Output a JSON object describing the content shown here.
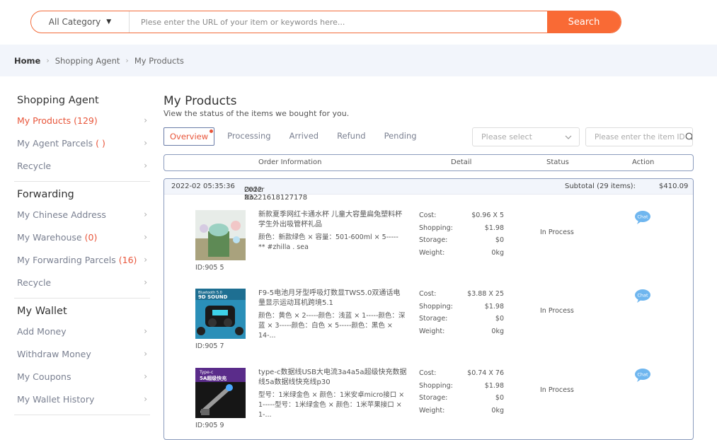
{
  "search": {
    "category_label": "All Category",
    "placeholder": "Plese enter the URL of your item or keywords here...",
    "button_label": "Search"
  },
  "breadcrumb": {
    "home": "Home",
    "level1": "Shopping Agent",
    "level2": "My Products"
  },
  "sidebar": {
    "sections": [
      {
        "title": "Shopping Agent",
        "items": [
          {
            "label": "My Products",
            "count": "(129)",
            "active": true
          },
          {
            "label": "My Agent Parcels",
            "count": "(   )"
          },
          {
            "label": "Recycle",
            "count": ""
          }
        ]
      },
      {
        "title": "Forwarding",
        "items": [
          {
            "label": "My Chinese Address",
            "count": ""
          },
          {
            "label": "My Warehouse",
            "count": "(0)"
          },
          {
            "label": "My Forwarding Parcels",
            "count": "(16)"
          },
          {
            "label": "Recycle",
            "count": ""
          }
        ]
      },
      {
        "title": "My Wallet",
        "items": [
          {
            "label": "Add Money",
            "count": ""
          },
          {
            "label": "Withdraw Money",
            "count": ""
          },
          {
            "label": "My Coupons",
            "count": ""
          },
          {
            "label": "My Wallet History",
            "count": ""
          }
        ]
      }
    ]
  },
  "page": {
    "title": "My Products",
    "subtitle": "View the status of the items we bought for you."
  },
  "tabs": [
    "Overview",
    "Processing",
    "Arrived",
    "Refund",
    "Pending"
  ],
  "filter": {
    "select_placeholder": "Please select",
    "item_search_placeholder": "Please enter the item ID"
  },
  "table_headers": {
    "order_info": "Order Information",
    "detail": "Detail",
    "status": "Status",
    "action": "Action"
  },
  "order": {
    "date": "2022-02   05:35:36",
    "order_no_label": "Order No.:",
    "order_no": "2022     23221618127178",
    "subtotal_label": "Subtotal (29 items):",
    "subtotal": "$410.09"
  },
  "cost_labels": {
    "cost": "Cost:",
    "shopping": "Shopping:",
    "storage": "Storage:",
    "weight": "Weight:"
  },
  "products": [
    {
      "name": "新款夏季网红卡通水杯 儿童大容量扁兔塑料杯学生外出吸管杯礼品",
      "spec": "颜色：新款绿色 × 容量：501-600ml × 5----- ** #zhilla . sea",
      "id": "ID:905     5",
      "cost": "$0.96 X 5",
      "shopping": "$1.98",
      "storage": "$0",
      "weight": "0kg",
      "status": "In Process",
      "chat": "Chat"
    },
    {
      "name": "F9-5电池月牙型呼吸灯数显TWS5.0双通话电量显示运动耳机跨境5.1",
      "spec": "颜色：黄色 × 2-----颜色：浅蓝 × 1-----颜色：深蓝 × 3-----颜色：白色 × 5-----颜色：黑色 × 14-...",
      "id": "ID:905     7",
      "cost": "$3.88 X 25",
      "shopping": "$1.98",
      "storage": "$0",
      "weight": "0kg",
      "status": "In Process",
      "chat": "Chat"
    },
    {
      "name": "type-c数据线USB大电流3a4a5a超级快充数据线5a数据线快充线p30",
      "spec": "型号：1米绿金色 × 颜色：1米安卓micro接口 × 1-----型号：1米绿金色 × 颜色：1米苹果接口 × 1-...",
      "id": "ID:905     9",
      "cost": "$0.74 X 76",
      "shopping": "$1.98",
      "storage": "$0",
      "weight": "0kg",
      "status": "In Process",
      "chat": "Chat"
    }
  ],
  "thumb_texts": {
    "p2_line1": "Bluetooth 5.0",
    "p2_line2": "9D SOUND",
    "p3_line1": "Type-c",
    "p3_line2": "5A超级快充"
  },
  "colors": {
    "accent": "#f96a35",
    "active_text": "#e8553a",
    "border": "#8b9bbd",
    "crumb_bg": "#f2f5fb"
  }
}
